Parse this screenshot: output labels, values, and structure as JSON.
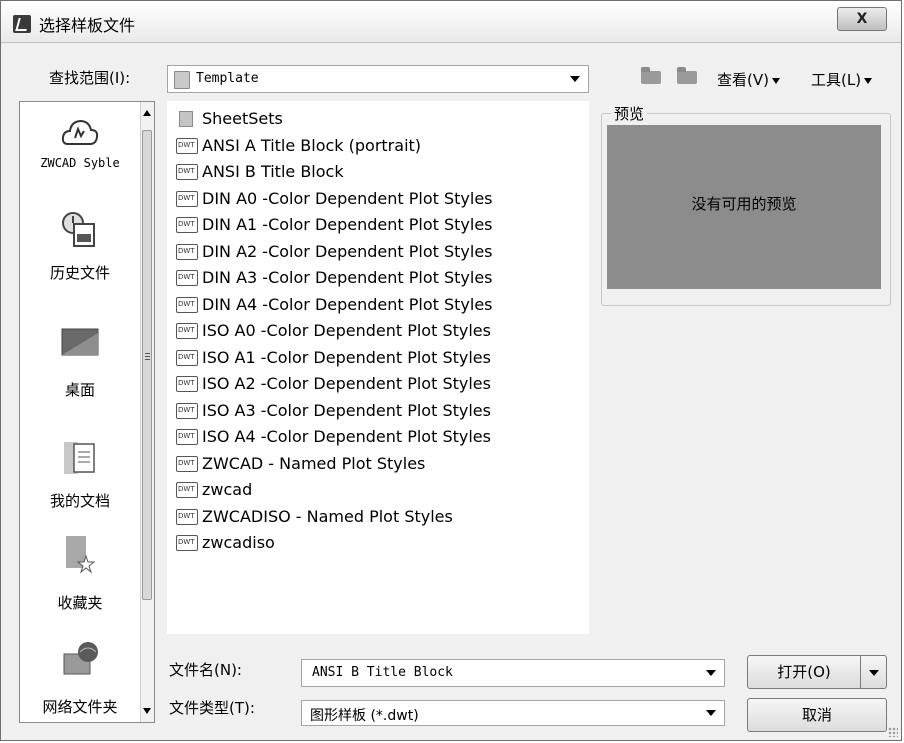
{
  "window": {
    "title": "选择样板文件",
    "close_label": "X"
  },
  "toolbar": {
    "look_in_label": "查找范围(I):",
    "look_in_value": "Template",
    "view_menu": "查看(V)",
    "tools_menu": "工具(L)"
  },
  "places": {
    "items": [
      {
        "label": "ZWCAD Syble",
        "icon": "zwcad-cloud-icon"
      },
      {
        "label": "历史文件",
        "icon": "history-icon"
      },
      {
        "label": "桌面",
        "icon": "desktop-icon"
      },
      {
        "label": "我的文档",
        "icon": "documents-icon"
      },
      {
        "label": "收藏夹",
        "icon": "favorites-icon"
      },
      {
        "label": "网络文件夹",
        "icon": "network-folder-icon"
      }
    ]
  },
  "files": {
    "items": [
      {
        "name": "SheetSets",
        "type": "folder"
      },
      {
        "name": "ANSI A Title Block (portrait)",
        "type": "dwt"
      },
      {
        "name": "ANSI B Title Block",
        "type": "dwt"
      },
      {
        "name": "DIN A0 -Color Dependent Plot Styles",
        "type": "dwt"
      },
      {
        "name": "DIN A1 -Color Dependent Plot Styles",
        "type": "dwt"
      },
      {
        "name": "DIN A2 -Color Dependent Plot Styles",
        "type": "dwt"
      },
      {
        "name": "DIN A3 -Color Dependent Plot Styles",
        "type": "dwt"
      },
      {
        "name": "DIN A4 -Color Dependent Plot Styles",
        "type": "dwt"
      },
      {
        "name": "ISO A0 -Color Dependent Plot Styles",
        "type": "dwt"
      },
      {
        "name": "ISO A1 -Color Dependent Plot Styles",
        "type": "dwt"
      },
      {
        "name": "ISO A2 -Color Dependent Plot Styles",
        "type": "dwt"
      },
      {
        "name": "ISO A3 -Color Dependent Plot Styles",
        "type": "dwt"
      },
      {
        "name": "ISO A4 -Color Dependent Plot Styles",
        "type": "dwt"
      },
      {
        "name": "ZWCAD - Named Plot Styles",
        "type": "dwt"
      },
      {
        "name": "zwcad",
        "type": "dwt"
      },
      {
        "name": "ZWCADISO - Named Plot Styles",
        "type": "dwt"
      },
      {
        "name": "zwcadiso",
        "type": "dwt"
      }
    ]
  },
  "preview": {
    "label": "预览",
    "empty_text": "没有可用的预览"
  },
  "footer": {
    "filename_label": "文件名(N):",
    "filename_value": "ANSI B Title Block",
    "filetype_label": "文件类型(T):",
    "filetype_value": "图形样板 (*.dwt)",
    "open_label": "打开(O)",
    "cancel_label": "取消"
  }
}
